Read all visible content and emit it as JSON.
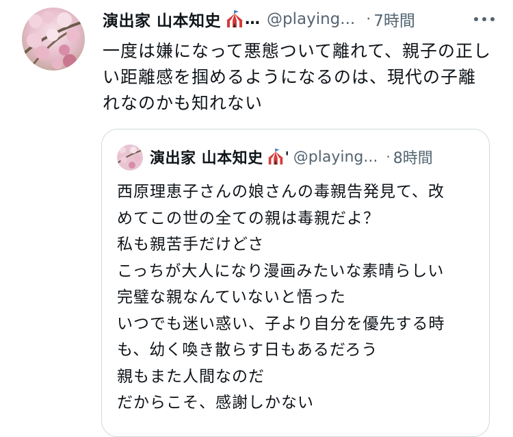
{
  "tweet": {
    "author_name": "演出家 山本知史",
    "name_ellipsis": "…",
    "handle": "@playing...",
    "separator": "·",
    "time": "7時間",
    "text": "一度は嫌になって悪態ついて離れて、親子の正しい距離感を掴めるようになるのは、現代の子離れなのかも知れない"
  },
  "quoted_tweet": {
    "author_name": "演出家 山本知史",
    "name_ellipsis": "'",
    "handle": "@playing...",
    "separator": "·",
    "time": "8時間",
    "lines": [
      "西原理恵子さんの娘さんの毒親告発見て、改",
      "めてこの世の全ての親は毒親だよ？",
      "私も親苦手だけどさ",
      "こっちが大人になり漫画みたいな素晴らしい",
      "完璧な親なんていないと悟った",
      "いつでも迷い惑い、子より自分を優先する時",
      "も、幼く喚き散らす日もあるだろう",
      "親もまた人間なのだ",
      "だからこそ、感謝しかない"
    ]
  },
  "icons": {
    "name_emoji": "circus-tent-icon",
    "more": "more-horizontal-icon"
  },
  "colors": {
    "text": "#0f1419",
    "secondary": "#536471",
    "border": "#cfd9de",
    "tent_red": "#d63a3a",
    "avatar_pink": "#e8b4c8"
  }
}
